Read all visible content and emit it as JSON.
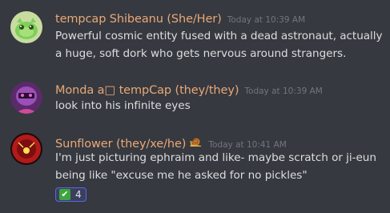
{
  "messages": [
    {
      "username": "tempcap Shibeanu (She/Her)",
      "timestamp": "Today at 10:39 AM",
      "avatar_icon": "green-creature-avatar",
      "lines": [
        "Powerful cosmic entity fused with a dead astronaut, actually",
        "a huge, soft dork who gets nervous around strangers."
      ]
    },
    {
      "username": "Monda a□ tempCap (they/they)",
      "timestamp": "Today at 10:39 AM",
      "avatar_icon": "purple-character-avatar",
      "lines": [
        "look into his infinite eyes"
      ]
    },
    {
      "username": "Sunflower (they/xe/he)",
      "timestamp": "Today at 10:41 AM",
      "avatar_icon": "red-circle-avatar",
      "name_emoji": "snail-icon",
      "lines": [
        "I'm just picturing ephraim and like- maybe scratch or ji-eun",
        "being like \"excuse me he asked for no pickles\""
      ],
      "reaction": {
        "emoji": "✔",
        "count": "4"
      }
    }
  ],
  "colors": {
    "background": "#36393f",
    "username": "#e9a878",
    "timestamp": "#72767d",
    "text": "#dcddde",
    "reaction_border": "#5865f2",
    "reaction_bg": "#3b405a"
  }
}
